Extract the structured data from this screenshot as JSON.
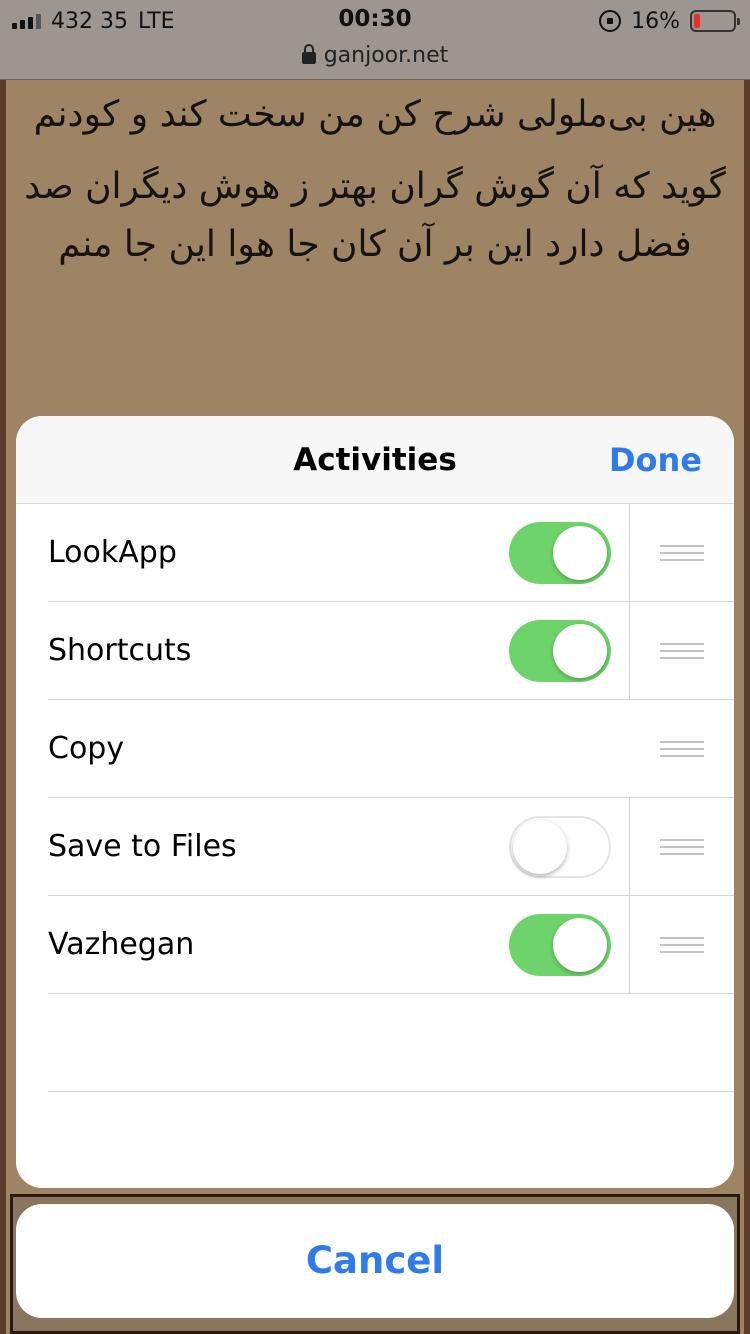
{
  "status": {
    "carrier": "432 35",
    "network": "LTE",
    "time": "00:30",
    "battery": "16%",
    "battery_level": 0.16,
    "url": "ganjoor.net"
  },
  "poem": {
    "verse1": "هین بی‌ملولی شرح کن من سخت کند و کودنم",
    "verse2": "گوید که آن گوش گران بهتر ز هوش دیگران صد فضل دارد این بر آن کان جا هوا این جا منم"
  },
  "sheet": {
    "title": "Activities",
    "done_label": "Done",
    "rows": [
      {
        "label": "LookApp",
        "toggle": true
      },
      {
        "label": "Shortcuts",
        "toggle": true
      },
      {
        "label": "Copy",
        "toggle": null
      },
      {
        "label": "Save to Files",
        "toggle": false
      },
      {
        "label": "Vazhegan",
        "toggle": true
      }
    ]
  },
  "cancel_label": "Cancel",
  "colors": {
    "accent": "#2f7bea",
    "toggle_on": "#6dd36a",
    "battery_low": "#e9312a"
  }
}
